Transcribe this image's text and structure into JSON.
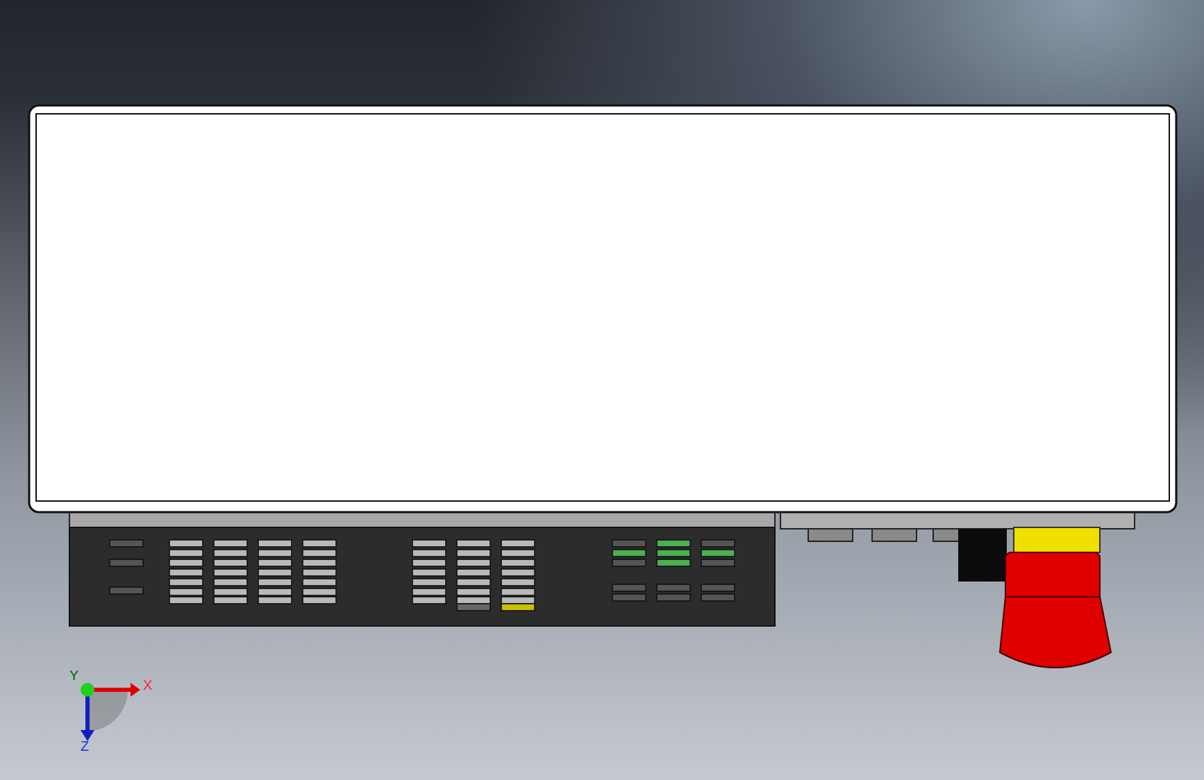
{
  "axis_triad": {
    "labels": [
      {
        "text": "X",
        "color": "#ff2020"
      },
      {
        "text": "Y",
        "color": "#006400"
      },
      {
        "text": "Z",
        "color": "#2030d0"
      }
    ]
  }
}
